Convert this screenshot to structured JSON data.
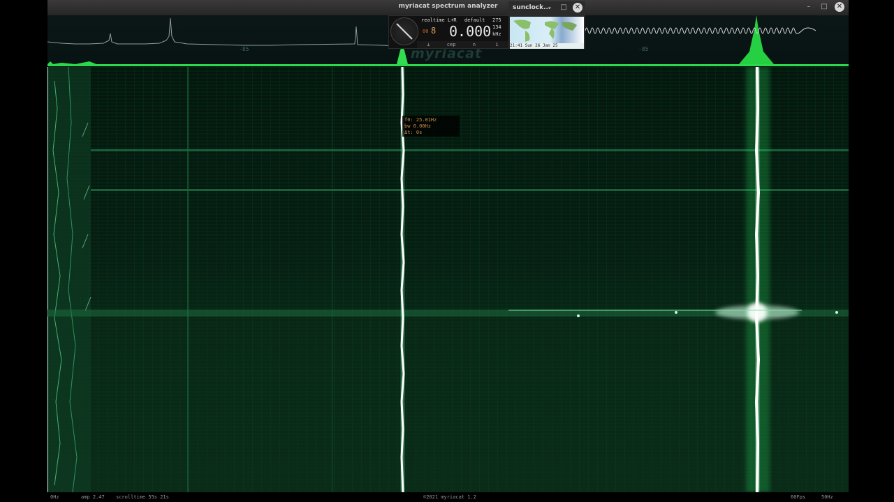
{
  "main_window": {
    "title": "myriacat spectrum analyzer",
    "buttons": [
      "–",
      "□",
      "✕"
    ]
  },
  "spectrum": {
    "db_labels": [
      "-85",
      "-85"
    ],
    "brand": "myriacat"
  },
  "widget": {
    "mode": "realtime",
    "channels": "L+R",
    "preset": "default",
    "top_right_value": "275",
    "small_left": "00",
    "digit": "8",
    "frequency": "0.000",
    "freq_small": "134",
    "unit": "kHz",
    "bottom_buttons": [
      "⊥",
      "cep",
      "∩",
      "i"
    ]
  },
  "sunclock": {
    "title": "sunclock...",
    "buttons": [
      "–",
      "□",
      "✕"
    ],
    "time": "21:41 Sun 26 Jan 25"
  },
  "cursor_info": {
    "f0": "f0: 25.01Hz",
    "bw": "bw 0.00Hz",
    "dt": "Δt: 0s"
  },
  "status": {
    "left_freq": "0Hz",
    "amp": "amp 2.47",
    "scrolltime": "scrolltime 55s 21s",
    "copyright": "©2021 myriacat 1.2",
    "fps": "60Fps",
    "right_freq": "50Hz"
  },
  "colors": {
    "waterfall_bg": "#061a10",
    "signal": "#ffffff",
    "glow": "#2aff5a"
  }
}
